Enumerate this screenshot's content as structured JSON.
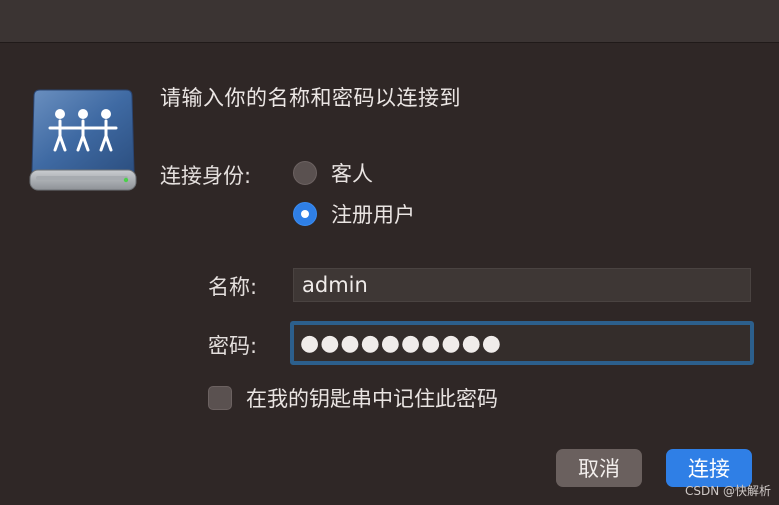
{
  "dialog": {
    "prompt": "请输入你的名称和密码以连接到",
    "connect_as_label": "连接身份:",
    "radio_options": [
      {
        "label": "客人",
        "selected": false
      },
      {
        "label": "注册用户",
        "selected": true
      }
    ],
    "name_label": "名称:",
    "name_value": "admin",
    "password_label": "密码:",
    "password_value": "●●●●●●●●●●",
    "remember_label": "在我的钥匙串中记住此密码",
    "remember_checked": false,
    "cancel_label": "取消",
    "connect_label": "连接"
  },
  "icons": {
    "server": "network-server-icon"
  },
  "colors": {
    "background": "#2f2726",
    "accent": "#2f7fe6",
    "focus_ring": "#2c5f8c"
  },
  "watermark": "CSDN @快解析"
}
